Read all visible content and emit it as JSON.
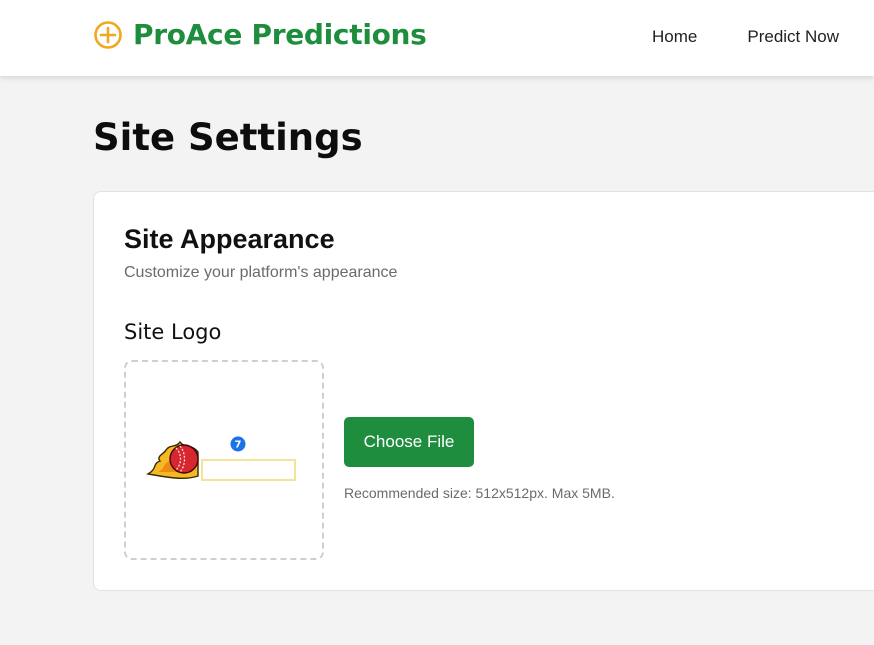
{
  "header": {
    "brand_name": "ProAce Predictions",
    "brand_icon": "plus-circle-icon",
    "nav": [
      {
        "label": "Home"
      },
      {
        "label": "Predict Now"
      }
    ]
  },
  "page": {
    "title": "Site Settings"
  },
  "appearance": {
    "title": "Site Appearance",
    "subtitle": "Customize your platform's appearance",
    "logo_label": "Site Logo",
    "logo_preview_icon": "cricket-ball-logo-icon",
    "badge_text": "7",
    "choose_file_label": "Choose File",
    "hint": "Recommended size: 512x512px. Max 5MB."
  },
  "colors": {
    "brand_green": "#1e8e3e",
    "icon_orange": "#f0a81e",
    "background": "#f3f3f3"
  }
}
